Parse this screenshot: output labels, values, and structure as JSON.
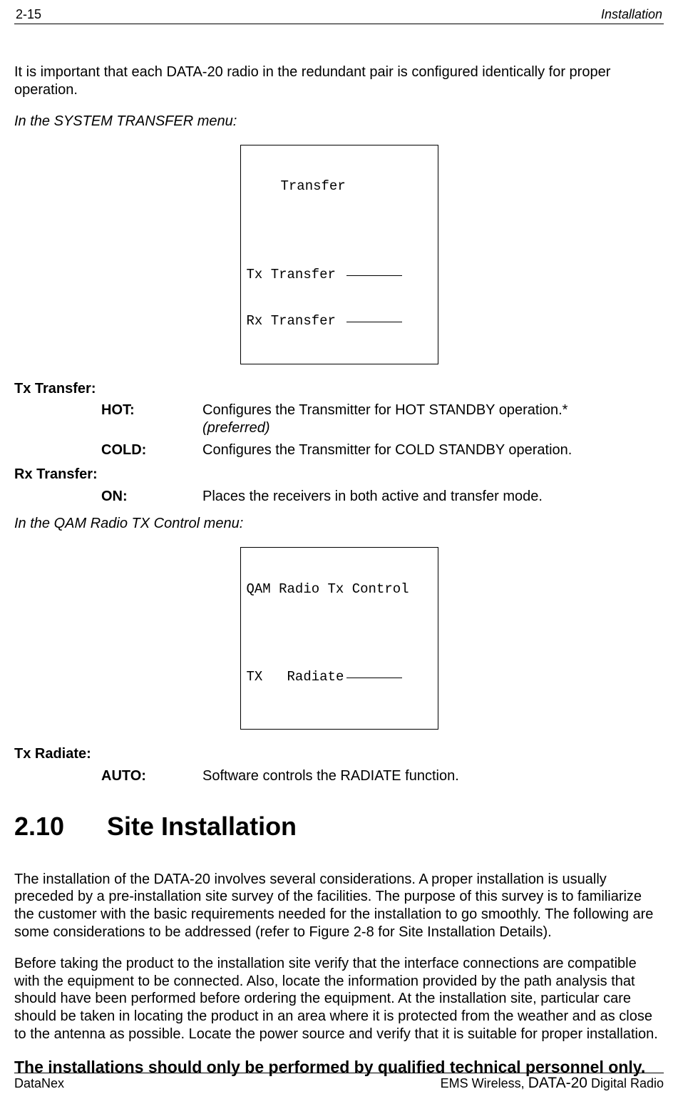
{
  "header": {
    "page_no": "2-15",
    "section": "Installation"
  },
  "intro": "It is important that each DATA-20 radio in the redundant pair is configured identically for proper operation.",
  "menu1_caption": "In the SYSTEM TRANSFER menu:",
  "menu1": {
    "title": "Transfer",
    "row1": "Tx Transfer",
    "row2": "Rx Transfer"
  },
  "txtransfer": {
    "heading": "Tx Transfer:",
    "hot": {
      "label": "HOT:",
      "text_a": "Configures the Transmitter for HOT STANDBY operation.*",
      "text_b": "(preferred)"
    },
    "cold": {
      "label": "COLD:",
      "text": "Configures the Transmitter for COLD STANDBY operation."
    }
  },
  "rxtransfer": {
    "heading": "Rx Transfer:",
    "on": {
      "label": "ON:",
      "text": "Places the receivers in both active and transfer mode."
    }
  },
  "menu2_caption": "In the QAM Radio TX Control menu:",
  "menu2": {
    "title": "QAM Radio Tx Control",
    "row1a": "TX",
    "row1b": "Radiate"
  },
  "txradiate": {
    "heading": "Tx Radiate:",
    "auto": {
      "label": "AUTO:",
      "text": "Software controls the RADIATE function."
    }
  },
  "section": {
    "num": "2.10",
    "title": "Site Installation"
  },
  "para1": "The installation of the DATA-20  involves several considerations.  A proper installation is usually preceded by a pre-installation site survey of the facilities.  The purpose of this survey is to familiarize the customer with the basic requirements needed for the installation to go smoothly.  The following are some considerations to be addressed (refer to Figure 2-8 for Site Installation Details).",
  "para2": "Before taking the product to the installation site verify that the interface connections are compatible with the equipment to be connected.  Also, locate the information provided by the path analysis that should have been performed before ordering the equipment.  At the installation site, particular care should be taken in locating the product in an area where it is protected from the weather and as close to the antenna as possible.  Locate the power source and verify that it is suitable for proper installation.",
  "para3": "The installations should only be performed by qualified technical personnel only.",
  "footer": {
    "left": "DataNex",
    "right_a": "EMS Wireless, ",
    "right_b": "DATA-20",
    "right_c": " Digital Radio"
  }
}
